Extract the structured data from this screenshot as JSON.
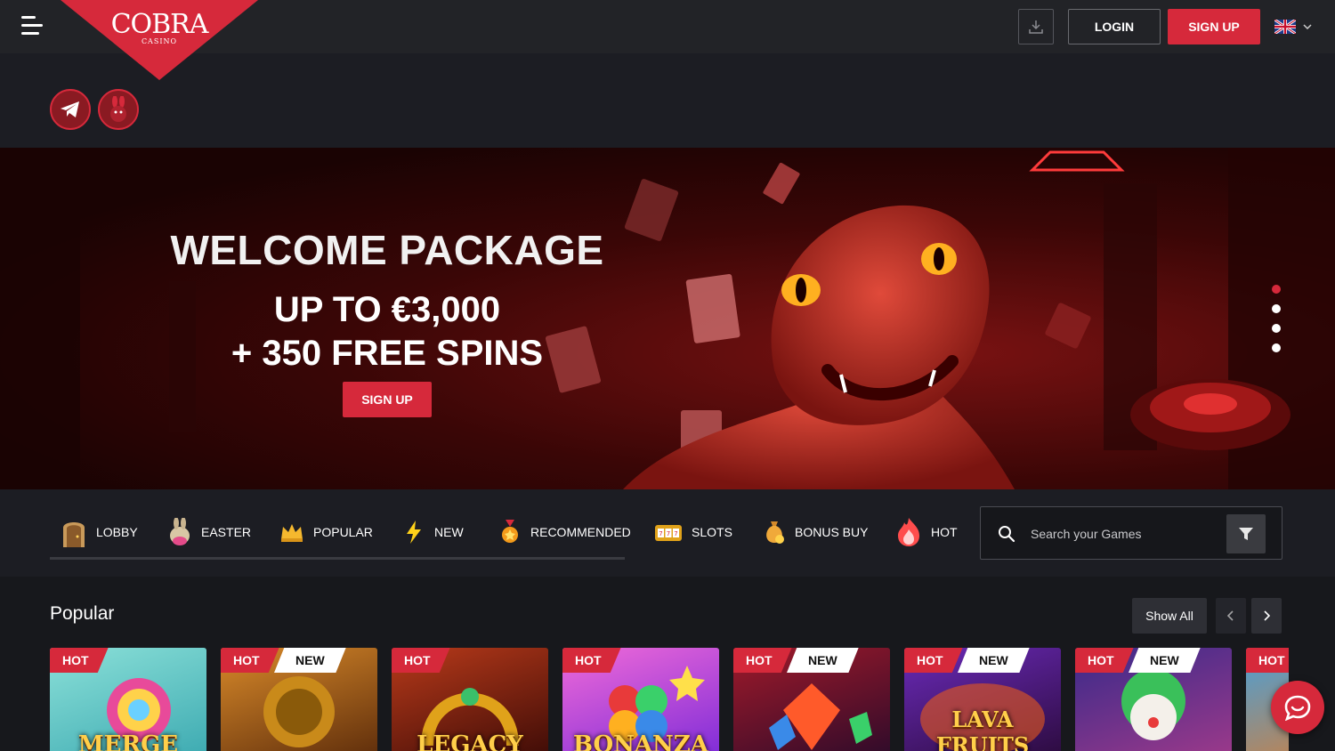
{
  "header": {
    "logo_text": "COBRA",
    "logo_subtext": "CASINO",
    "login_label": "LOGIN",
    "signup_label": "SIGN UP",
    "language": "gb-flag-icon"
  },
  "socials": [
    {
      "name": "telegram-icon"
    },
    {
      "name": "rabbit-icon"
    }
  ],
  "hero": {
    "title": "WELCOME PACKAGE",
    "line1": "UP TO €3,000",
    "line2": "+ 350 FREE SPINS",
    "button": "SIGN UP",
    "slides_count": 4,
    "active_slide": 1
  },
  "categories": [
    {
      "label": "LOBBY",
      "icon": "door-icon"
    },
    {
      "label": "EASTER",
      "icon": "easter-bunny-icon"
    },
    {
      "label": "POPULAR",
      "icon": "crown-icon"
    },
    {
      "label": "NEW",
      "icon": "lightning-icon"
    },
    {
      "label": "RECOMMENDED",
      "icon": "medal-icon"
    },
    {
      "label": "SLOTS",
      "icon": "slot-machine-icon"
    },
    {
      "label": "BONUS BUY",
      "icon": "money-bag-icon"
    },
    {
      "label": "HOT",
      "icon": "fire-icon"
    }
  ],
  "search": {
    "placeholder": "Search your Games"
  },
  "popular": {
    "title": "Popular",
    "show_all": "Show All",
    "cards": [
      {
        "title": "MERGE",
        "badges": [
          "HOT"
        ],
        "bg": "#6bd0c9"
      },
      {
        "title": "",
        "badges": [
          "HOT",
          "NEW"
        ],
        "bg": "#a0561a"
      },
      {
        "title": "LEGACY",
        "badges": [
          "HOT"
        ],
        "bg": "#7a1a10"
      },
      {
        "title": "BONANZA",
        "badges": [
          "HOT"
        ],
        "bg": "#c84bd8"
      },
      {
        "title": "",
        "badges": [
          "HOT",
          "NEW"
        ],
        "bg": "#8a1a2a"
      },
      {
        "title": "LAVA FRUITS",
        "badges": [
          "HOT",
          "NEW"
        ],
        "bg": "#3a1a6a"
      },
      {
        "title": "",
        "badges": [
          "HOT",
          "NEW"
        ],
        "bg": "#5a2a8a"
      },
      {
        "title": "",
        "badges": [
          "HOT"
        ],
        "bg": "#2a6a9a"
      }
    ]
  },
  "colors": {
    "accent": "#d6293b",
    "topbar": "#222327",
    "panel": "#1c1d23"
  }
}
